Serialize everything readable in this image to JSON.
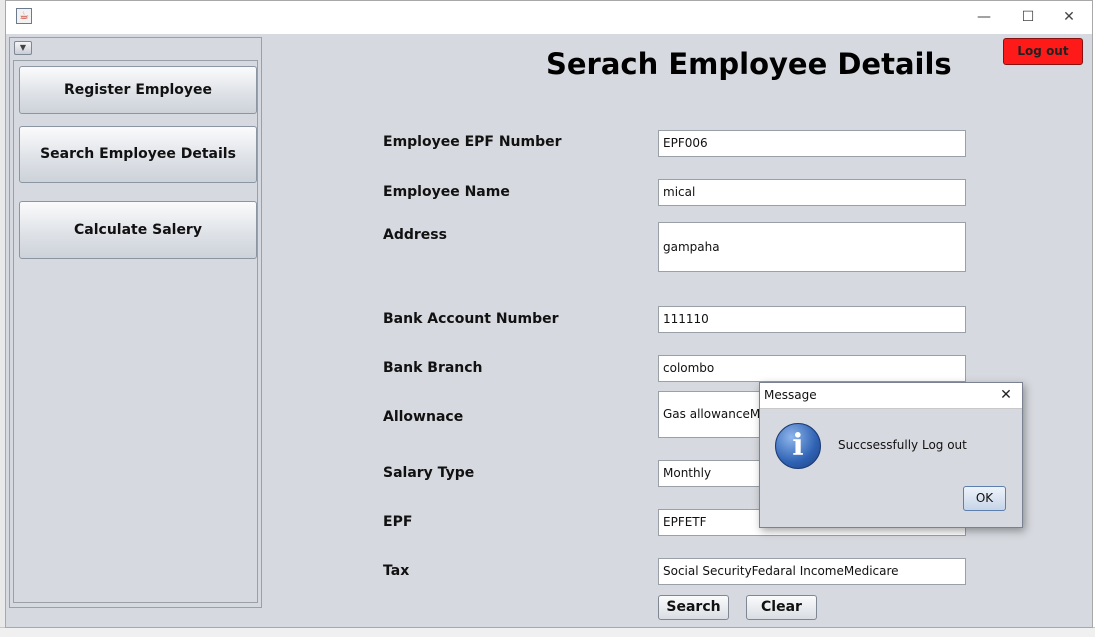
{
  "window": {
    "controls": {
      "minimize": "—",
      "maximize": "☐",
      "close": "✕"
    }
  },
  "header": {
    "title": "Serach Employee Details",
    "logout_label": "Log out",
    "logout_color": "#ff1a1a"
  },
  "sidebar": {
    "toggle_glyph": "▼",
    "items": [
      {
        "label": "Register Employee"
      },
      {
        "label": "Search Employee Details"
      },
      {
        "label": "Calculate Salery"
      }
    ]
  },
  "form": {
    "fields": [
      {
        "label": "Employee EPF Number",
        "value": "EPF006"
      },
      {
        "label": "Employee Name",
        "value": "mical"
      },
      {
        "label": "Address",
        "value": "gampaha"
      },
      {
        "label": "Bank Account Number",
        "value": "111110"
      },
      {
        "label": "Bank Branch",
        "value": "colombo"
      },
      {
        "label": "Allownace",
        "value": "Gas allowanceMo"
      },
      {
        "label": "Salary Type",
        "value": "Monthly"
      },
      {
        "label": "EPF",
        "value": "EPFETF"
      },
      {
        "label": "Tax",
        "value": "Social SecurityFedaral IncomeMedicare"
      }
    ],
    "search_label": "Search",
    "clear_label": "Clear"
  },
  "dialog": {
    "title": "Message",
    "message": "Succsessfully Log out",
    "ok_label": "OK",
    "icon": "info-icon",
    "close_glyph": "✕"
  }
}
